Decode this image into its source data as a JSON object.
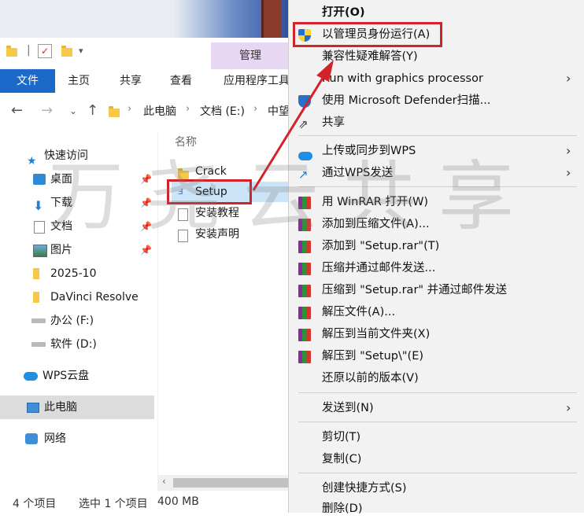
{
  "ribbon": {
    "manage_tab": "管理",
    "tabs": [
      "文件",
      "主页",
      "共享",
      "查看",
      "应用程序工具"
    ]
  },
  "address": {
    "crumbs": [
      "此电脑",
      "文档 (E:)",
      "中望"
    ]
  },
  "sidebar": {
    "items": [
      {
        "label": "快速访问"
      },
      {
        "label": "桌面"
      },
      {
        "label": "下载"
      },
      {
        "label": "文档"
      },
      {
        "label": "图片"
      },
      {
        "label": "2025-10"
      },
      {
        "label": "DaVinci Resolve"
      },
      {
        "label": "办公 (F:)"
      },
      {
        "label": "软件 (D:)"
      },
      {
        "label": "WPS云盘"
      },
      {
        "label": "此电脑"
      },
      {
        "label": "网络"
      }
    ]
  },
  "filelist": {
    "column_name": "名称",
    "files": [
      {
        "name": "Crack"
      },
      {
        "name": "Setup"
      },
      {
        "name": "安装教程"
      },
      {
        "name": "安装声明"
      }
    ]
  },
  "status": {
    "count": "4 个项目",
    "selected": "选中 1 个项目",
    "size": "400 MB"
  },
  "context_menu": {
    "items": [
      {
        "label": "打开(O)"
      },
      {
        "label": "以管理员身份运行(A)"
      },
      {
        "label": "兼容性疑难解答(Y)"
      },
      {
        "label": "Run with graphics processor"
      },
      {
        "label": "使用 Microsoft Defender扫描..."
      },
      {
        "label": "共享"
      },
      {
        "label": "上传或同步到WPS"
      },
      {
        "label": "通过WPS发送"
      },
      {
        "label": "用 WinRAR 打开(W)"
      },
      {
        "label": "添加到压缩文件(A)..."
      },
      {
        "label": "添加到 \"Setup.rar\"(T)"
      },
      {
        "label": "压缩并通过邮件发送..."
      },
      {
        "label": "压缩到 \"Setup.rar\" 并通过邮件发送"
      },
      {
        "label": "解压文件(A)..."
      },
      {
        "label": "解压到当前文件夹(X)"
      },
      {
        "label": "解压到 \"Setup\\\"(E)"
      },
      {
        "label": "还原以前的版本(V)"
      },
      {
        "label": "发送到(N)"
      },
      {
        "label": "剪切(T)"
      },
      {
        "label": "复制(C)"
      },
      {
        "label": "创建快捷方式(S)"
      },
      {
        "label": "删除(D)"
      }
    ]
  },
  "watermark": "万尧云共享",
  "colors": {
    "highlight": "#d3232a",
    "accent": "#1b6ac9",
    "selection": "#cce4f7"
  }
}
